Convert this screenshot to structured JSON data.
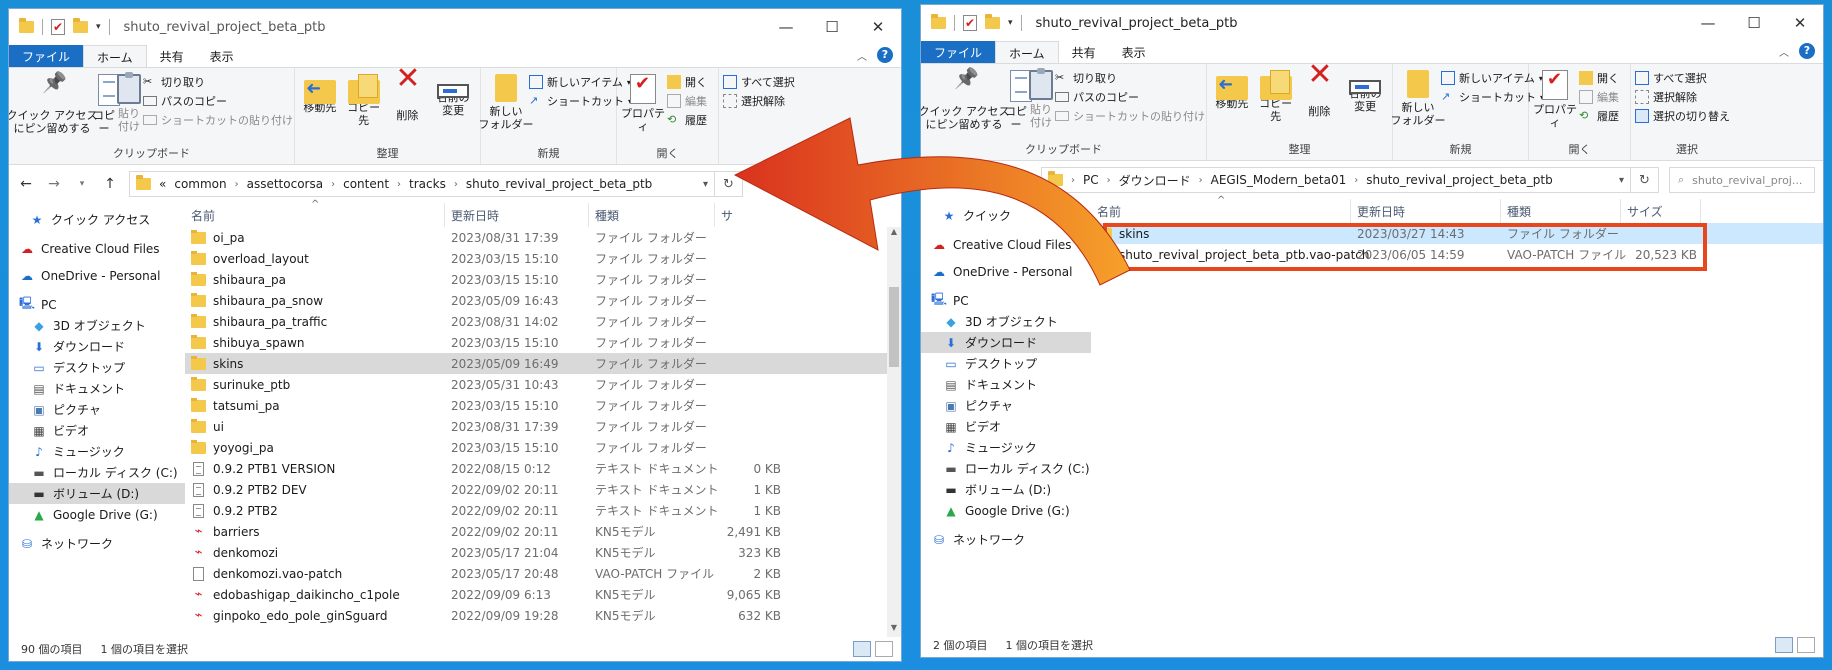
{
  "colors": {
    "file_tab": "#1a6fc4",
    "folder": "#f4c84a",
    "highlight": "#e8471e",
    "arrow_start": "#f6a12a",
    "arrow_end": "#d9321e"
  },
  "left": {
    "title": "shuto_revival_project_beta_ptb",
    "tabs": [
      "ファイル",
      "ホーム",
      "共有",
      "表示"
    ],
    "ribbon": {
      "clipboard": {
        "label": "クリップボード",
        "pin": "クイック アクセス\nにピン留めする",
        "copy": "コピー",
        "paste": "貼り付け",
        "cut": "切り取り",
        "copy_path": "パスのコピー",
        "paste_shortcut": "ショートカットの貼り付け"
      },
      "organize": {
        "label": "整理",
        "move": "移動先",
        "copy_to": "コピー先",
        "delete": "削除",
        "rename": "名前の\n変更"
      },
      "new": {
        "label": "新規",
        "new_folder": "新しい\nフォルダー",
        "new_item": "新しいアイテム",
        "shortcut": "ショートカット"
      },
      "open": {
        "label": "開く",
        "properties": "プロパティ",
        "open": "開く",
        "edit": "編集",
        "history": "履歴"
      },
      "select": {
        "select_all": "すべて選択",
        "select_none": "選択解除"
      }
    },
    "breadcrumb": [
      "«",
      "common",
      "assettocorsa",
      "content",
      "tracks",
      "shuto_revival_project_beta_ptb"
    ],
    "columns": [
      "名前",
      "更新日時",
      "種類",
      "サ"
    ],
    "nav": [
      {
        "icon": "star-icon",
        "label": "クイック アクセス"
      },
      {
        "icon": "creative-cloud-icon",
        "label": "Creative Cloud Files"
      },
      {
        "icon": "cloud-icon",
        "label": "OneDrive - Personal"
      },
      {
        "icon": "pc-icon",
        "label": "PC"
      },
      {
        "icon": "cube-icon",
        "label": "3D オブジェクト"
      },
      {
        "icon": "download-icon",
        "label": "ダウンロード"
      },
      {
        "icon": "desktop-icon",
        "label": "デスクトップ"
      },
      {
        "icon": "document-icon",
        "label": "ドキュメント"
      },
      {
        "icon": "picture-icon",
        "label": "ピクチャ"
      },
      {
        "icon": "video-icon",
        "label": "ビデオ"
      },
      {
        "icon": "music-icon",
        "label": "ミュージック"
      },
      {
        "icon": "disk-icon",
        "label": "ローカル ディスク (C:)"
      },
      {
        "icon": "drive-icon",
        "label": "ボリューム (D:)"
      },
      {
        "icon": "google-drive-icon",
        "label": "Google Drive (G:)"
      },
      {
        "icon": "network-icon",
        "label": "ネットワーク"
      }
    ],
    "files": [
      {
        "type": "folder",
        "name": "oi_pa",
        "date": "2023/08/31 17:39",
        "kind": "ファイル フォルダー",
        "size": ""
      },
      {
        "type": "folder",
        "name": "overload_layout",
        "date": "2023/03/15 15:10",
        "kind": "ファイル フォルダー",
        "size": ""
      },
      {
        "type": "folder",
        "name": "shibaura_pa",
        "date": "2023/03/15 15:10",
        "kind": "ファイル フォルダー",
        "size": ""
      },
      {
        "type": "folder",
        "name": "shibaura_pa_snow",
        "date": "2023/05/09 16:43",
        "kind": "ファイル フォルダー",
        "size": ""
      },
      {
        "type": "folder",
        "name": "shibaura_pa_traffic",
        "date": "2023/08/31 14:02",
        "kind": "ファイル フォルダー",
        "size": ""
      },
      {
        "type": "folder",
        "name": "shibuya_spawn",
        "date": "2023/03/15 15:10",
        "kind": "ファイル フォルダー",
        "size": ""
      },
      {
        "type": "folder",
        "name": "skins",
        "date": "2023/05/09 16:49",
        "kind": "ファイル フォルダー",
        "size": "",
        "selected": true
      },
      {
        "type": "folder",
        "name": "surinuke_ptb",
        "date": "2023/05/31 10:43",
        "kind": "ファイル フォルダー",
        "size": ""
      },
      {
        "type": "folder",
        "name": "tatsumi_pa",
        "date": "2023/03/15 15:10",
        "kind": "ファイル フォルダー",
        "size": ""
      },
      {
        "type": "folder",
        "name": "ui",
        "date": "2023/08/31 17:39",
        "kind": "ファイル フォルダー",
        "size": ""
      },
      {
        "type": "folder",
        "name": "yoyogi_pa",
        "date": "2023/03/15 15:10",
        "kind": "ファイル フォルダー",
        "size": ""
      },
      {
        "type": "text",
        "name": "0.9.2 PTB1 VERSION",
        "date": "2022/08/15 0:12",
        "kind": "テキスト ドキュメント",
        "size": "0 KB"
      },
      {
        "type": "text",
        "name": "0.9.2 PTB2 DEV",
        "date": "2022/09/02 20:11",
        "kind": "テキスト ドキュメント",
        "size": "1 KB"
      },
      {
        "type": "text",
        "name": "0.9.2 PTB2",
        "date": "2022/09/02 20:11",
        "kind": "テキスト ドキュメント",
        "size": "1 KB"
      },
      {
        "type": "kn5",
        "name": "barriers",
        "date": "2022/09/02 20:11",
        "kind": "KN5モデル",
        "size": "2,491 KB"
      },
      {
        "type": "kn5",
        "name": "denkomozi",
        "date": "2023/05/17 21:04",
        "kind": "KN5モデル",
        "size": "323 KB"
      },
      {
        "type": "file",
        "name": "denkomozi.vao-patch",
        "date": "2023/05/17 20:48",
        "kind": "VAO-PATCH ファイル",
        "size": "2 KB"
      },
      {
        "type": "kn5",
        "name": "edobashigap_daikincho_c1pole",
        "date": "2022/09/09 6:13",
        "kind": "KN5モデル",
        "size": "9,065 KB"
      },
      {
        "type": "kn5",
        "name": "ginpoko_edo_pole_ginSguard",
        "date": "2022/09/09 19:28",
        "kind": "KN5モデル",
        "size": "632 KB"
      }
    ],
    "status": {
      "count": "90 個の項目",
      "selected": "1 個の項目を選択"
    }
  },
  "right": {
    "title": "shuto_revival_project_beta_ptb",
    "tabs": [
      "ファイル",
      "ホーム",
      "共有",
      "表示"
    ],
    "ribbon": {
      "clipboard": {
        "label": "クリップボード",
        "pin": "クイック アクセス\nにピン留めする",
        "copy": "コピー",
        "paste": "貼り付け",
        "cut": "切り取り",
        "copy_path": "パスのコピー",
        "paste_shortcut": "ショートカットの貼り付け"
      },
      "organize": {
        "label": "整理",
        "move": "移動先",
        "copy_to": "コピー先",
        "delete": "削除",
        "rename": "名前の\n変更"
      },
      "new": {
        "label": "新規",
        "new_folder": "新しい\nフォルダー",
        "new_item": "新しいアイテム",
        "shortcut": "ショートカット"
      },
      "open": {
        "label": "開く",
        "properties": "プロパティ",
        "open": "開く",
        "edit": "編集",
        "history": "履歴"
      },
      "select": {
        "label": "選択",
        "select_all": "すべて選択",
        "select_none": "選択解除",
        "invert": "選択の切り替え"
      }
    },
    "breadcrumb": [
      "PC",
      "ダウンロード",
      "AEGIS_Modern_beta01",
      "shuto_revival_project_beta_ptb"
    ],
    "search_placeholder": "shuto_revival_proj...",
    "columns": [
      "名前",
      "更新日時",
      "種類",
      "サイズ"
    ],
    "nav": [
      {
        "icon": "star-icon",
        "label": "クイック"
      },
      {
        "icon": "creative-cloud-icon",
        "label": "Creative Cloud Files"
      },
      {
        "icon": "cloud-icon",
        "label": "OneDrive - Personal"
      },
      {
        "icon": "pc-icon",
        "label": "PC"
      },
      {
        "icon": "cube-icon",
        "label": "3D オブジェクト"
      },
      {
        "icon": "download-icon",
        "label": "ダウンロード"
      },
      {
        "icon": "desktop-icon",
        "label": "デスクトップ"
      },
      {
        "icon": "document-icon",
        "label": "ドキュメント"
      },
      {
        "icon": "picture-icon",
        "label": "ピクチャ"
      },
      {
        "icon": "video-icon",
        "label": "ビデオ"
      },
      {
        "icon": "music-icon",
        "label": "ミュージック"
      },
      {
        "icon": "disk-icon",
        "label": "ローカル ディスク (C:)"
      },
      {
        "icon": "drive-icon",
        "label": "ボリューム (D:)"
      },
      {
        "icon": "google-drive-icon",
        "label": "Google Drive (G:)"
      },
      {
        "icon": "network-icon",
        "label": "ネットワーク"
      }
    ],
    "files": [
      {
        "type": "folder",
        "name": "skins",
        "date": "2023/03/27 14:43",
        "kind": "ファイル フォルダー",
        "size": "",
        "selected": true
      },
      {
        "type": "file",
        "name": "shuto_revival_project_beta_ptb.vao-patch",
        "date": "2023/06/05 14:59",
        "kind": "VAO-PATCH ファイル",
        "size": "20,523 KB"
      }
    ],
    "status": {
      "count": "2 個の項目",
      "selected": "1 個の項目を選択"
    }
  }
}
